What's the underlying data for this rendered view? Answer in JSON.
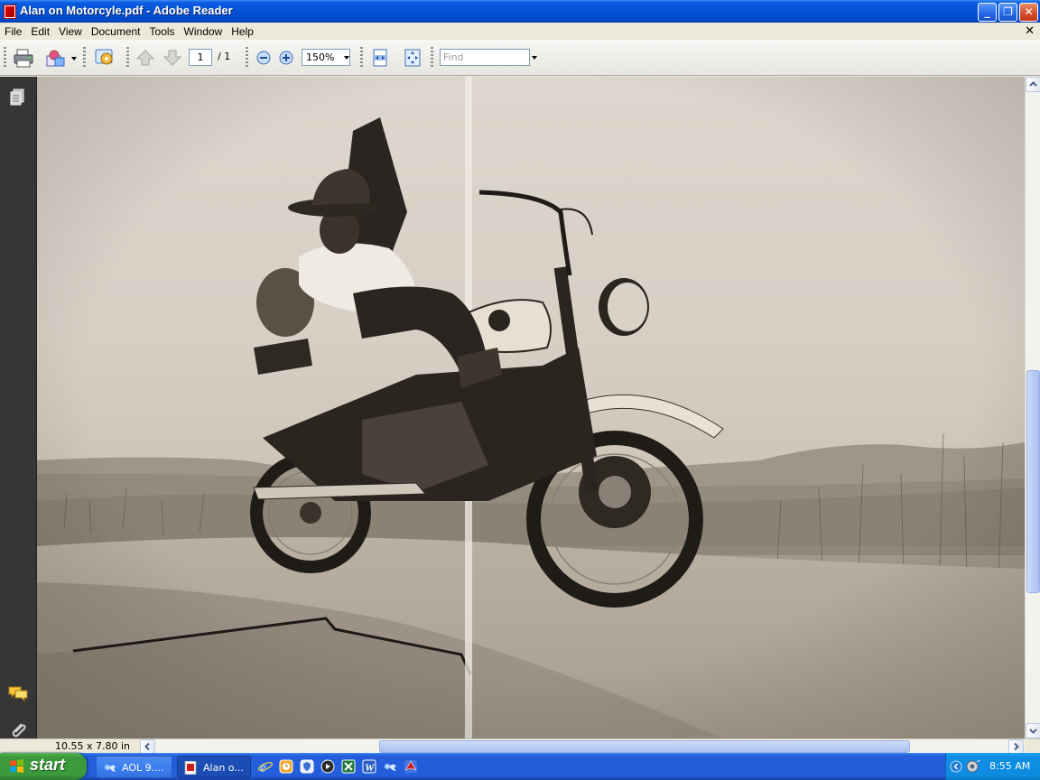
{
  "window": {
    "title": "Alan on Motorcyle.pdf - Adobe Reader",
    "buttons": {
      "minimize": "_",
      "maximize": "❐",
      "close": "✕"
    }
  },
  "menu": {
    "items": [
      "File",
      "Edit",
      "View",
      "Document",
      "Tools",
      "Window",
      "Help"
    ],
    "close_glyph": "✕"
  },
  "toolbar": {
    "page_current": "1",
    "page_total": "/ 1",
    "zoom": "150%",
    "find_placeholder": "Find"
  },
  "status": {
    "page_size": "10.55 x 7.80 in"
  },
  "taskbar": {
    "start_label": "start",
    "tasks": [
      {
        "label": "AOL 9....",
        "icon": "aol-icon"
      },
      {
        "label": "Alan o...",
        "icon": "pdf-icon"
      }
    ],
    "clock": "8:55 AM"
  },
  "colors": {
    "titlebar": "#0553d6",
    "taskbar": "#245edb",
    "start": "#3c9a3c",
    "tray": "#0d8ce0"
  }
}
